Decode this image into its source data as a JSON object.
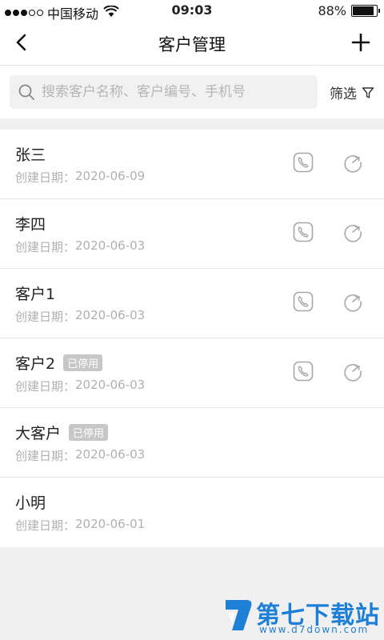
{
  "status_bar": {
    "carrier": "中国移动",
    "time": "09:03",
    "battery": "88%",
    "signal_strength": 3,
    "signal_total": 5
  },
  "nav": {
    "title": "客户管理",
    "back_icon": "chevron-left-icon",
    "add_icon": "plus-icon"
  },
  "search": {
    "placeholder": "搜索客户名称、客户编号、手机号",
    "value": "",
    "filter_label": "筛选"
  },
  "list": {
    "date_prefix": "创建日期：",
    "items": [
      {
        "name": "张三",
        "badge": "",
        "date": "2020-06-09",
        "show_actions": true
      },
      {
        "name": "李四",
        "badge": "",
        "date": "2020-06-03",
        "show_actions": true
      },
      {
        "name": "客户1",
        "badge": "",
        "date": "2020-06-03",
        "show_actions": true
      },
      {
        "name": "客户2",
        "badge": "已停用",
        "date": "2020-06-03",
        "show_actions": true
      },
      {
        "name": "大客户",
        "badge": "已停用",
        "date": "2020-06-03",
        "show_actions": false
      },
      {
        "name": "小明",
        "badge": "",
        "date": "2020-06-01",
        "show_actions": false
      }
    ]
  },
  "watermark": {
    "title": "第七下载站",
    "url": "www.d7down.com"
  },
  "colors": {
    "accent": "#1e7fd6",
    "badge_bg": "#c7c7c7",
    "muted_text": "#b0b0b0"
  }
}
